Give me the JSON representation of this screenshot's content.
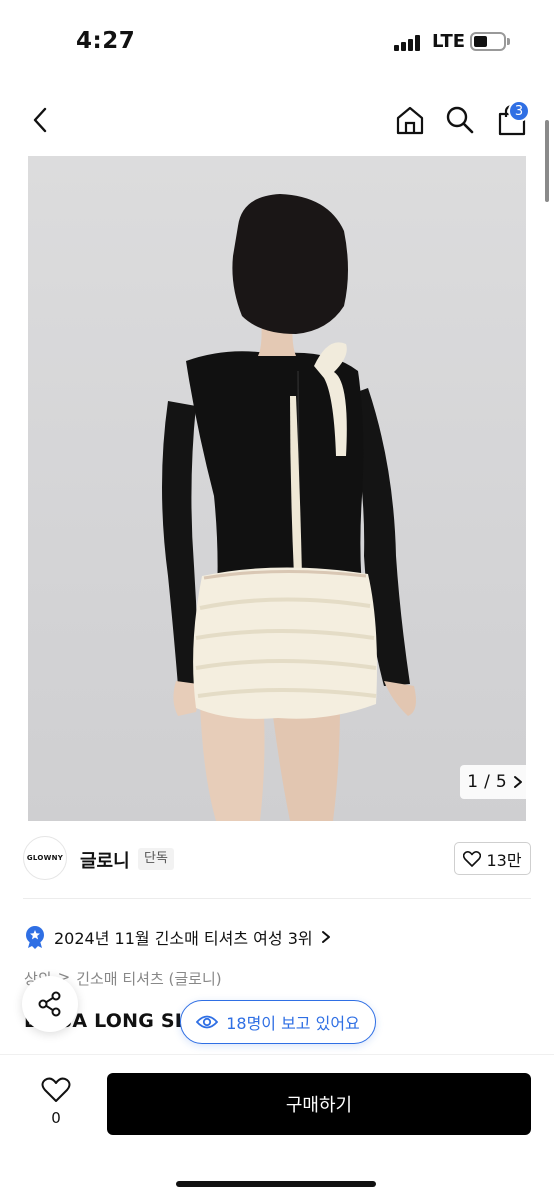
{
  "status_bar": {
    "time": "4:27",
    "network": "LTE",
    "battery_level": 0.45
  },
  "nav": {
    "cart_count": "3"
  },
  "gallery": {
    "current": "1",
    "total": "5",
    "separator": "/"
  },
  "brand": {
    "logo_text": "GLOWNY",
    "name": "글로니",
    "tag": "단독",
    "likes": "13만"
  },
  "ranking": {
    "text": "2024년 11월 긴소매 티셔츠 여성 3위"
  },
  "breadcrumb": {
    "level1": "상의",
    "separator": ">",
    "level2": "긴소매 티셔츠 (글로니)"
  },
  "product": {
    "title": "LUISA LONG SLEEVE (BLACK)"
  },
  "viewers": {
    "text": "18명이 보고 있어요"
  },
  "bottom": {
    "wish_count": "0",
    "buy_label": "구매하기"
  },
  "colors": {
    "accent": "#2f6fe4",
    "buy_button": "#000000"
  }
}
